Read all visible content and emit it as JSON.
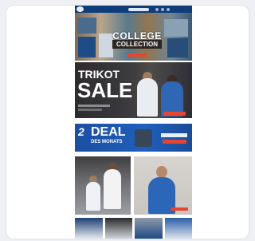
{
  "banners": {
    "college": {
      "title": "COLLEGE",
      "subtitle": "COLLECTION"
    },
    "trikot": {
      "line1": "TRIKOT",
      "line2": "SALE"
    },
    "deal": {
      "number": "2",
      "title": "DEAL",
      "subtitle": "DES MONATS"
    }
  },
  "colors": {
    "nav": "#0e3d7a",
    "accent": "#e6462f",
    "deal_bg": "#1f5fbd"
  }
}
